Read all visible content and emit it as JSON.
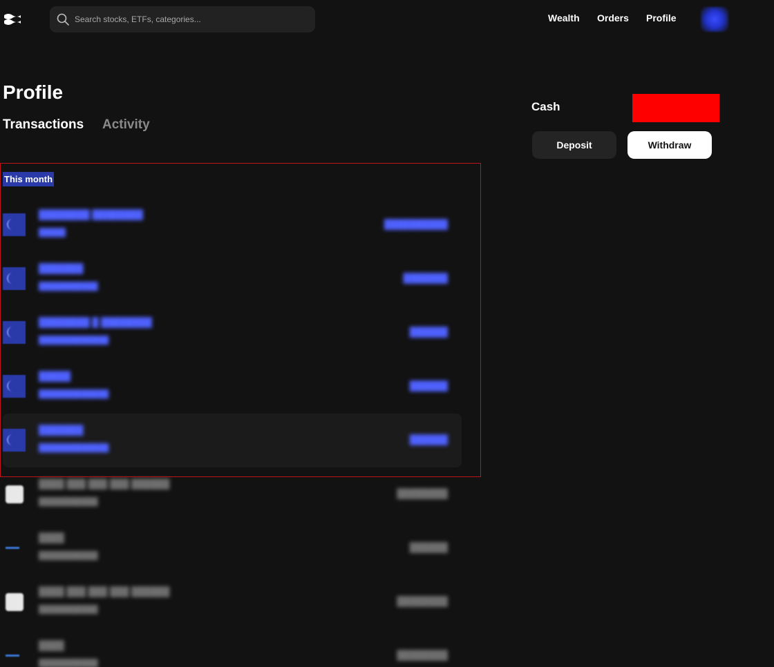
{
  "header": {
    "search": {
      "placeholder": "Search stocks, ETFs, categories..."
    },
    "nav": {
      "wealth": "Wealth",
      "orders": "Orders",
      "profile": "Profile"
    }
  },
  "main": {
    "title": "Profile",
    "tabs": [
      {
        "label": "Transactions",
        "active": true
      },
      {
        "label": "Activity",
        "active": false
      }
    ],
    "section_label": "This month",
    "transactions": [
      {
        "title": "",
        "subtitle": "",
        "amount": "",
        "style": "blue",
        "icon": "blue-square-icon",
        "selected": true
      },
      {
        "title": "",
        "subtitle": "",
        "amount": "",
        "style": "blue",
        "icon": "blue-square-icon",
        "selected": true
      },
      {
        "title": "",
        "subtitle": "",
        "amount": "",
        "style": "blue",
        "icon": "blue-square-icon",
        "selected": true
      },
      {
        "title": "",
        "subtitle": "",
        "amount": "",
        "style": "blue",
        "icon": "blue-square-icon",
        "selected": true
      },
      {
        "title": "",
        "subtitle": "",
        "amount": "",
        "style": "blue",
        "icon": "blue-square-icon",
        "selected": true,
        "hover": true
      },
      {
        "title": "",
        "subtitle": "",
        "amount": "",
        "style": "grey",
        "icon": "etf-icon"
      },
      {
        "title": "",
        "subtitle": "",
        "amount": "",
        "style": "grey",
        "icon": "line-icon"
      },
      {
        "title": "",
        "subtitle": "",
        "amount": "",
        "style": "grey",
        "icon": "etf-icon"
      },
      {
        "title": "",
        "subtitle": "",
        "amount": "",
        "style": "grey",
        "icon": "line-icon"
      }
    ]
  },
  "sidebar": {
    "cash_label": "Cash",
    "cash_value_redacted": true,
    "deposit_label": "Deposit",
    "withdraw_label": "Withdraw"
  },
  "colors": {
    "background": "#121212",
    "selection_border": "#c0121a",
    "selection_highlight": "#2a3aa8",
    "redaction": "#ff0000",
    "blurred_blue_text": "#4f62ff",
    "blurred_grey_text": "#6e6e6e"
  }
}
